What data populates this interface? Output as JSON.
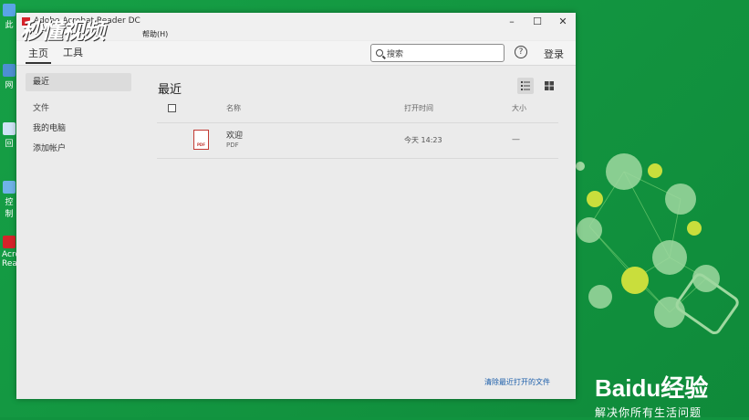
{
  "window": {
    "title": "Adobe Acrobat Reader DC",
    "menu_help": "帮助(H)",
    "controls": {
      "minimize": "–",
      "maximize": "☐",
      "close": "✕"
    }
  },
  "watermark": "秒懂视频",
  "toolbar": {
    "tabs": [
      {
        "label": "主页",
        "active": true
      },
      {
        "label": "工具",
        "active": false
      }
    ],
    "search_placeholder": "搜索",
    "help_icon": "?",
    "login_label": "登录"
  },
  "sidebar": {
    "recent": "最近",
    "files_header": "文件",
    "items": [
      "我的电脑",
      "添加帐户"
    ]
  },
  "main": {
    "title": "最近",
    "columns": {
      "name": "名称",
      "opened": "打开时间",
      "size": "大小"
    },
    "rows": [
      {
        "name": "欢迎",
        "type": "PDF",
        "opened": "今天 14:23",
        "size": "—"
      }
    ],
    "clear_link": "清除最近打开的文件"
  },
  "desktop_labels": {
    "this_pc": "此",
    "network": "网",
    "recycle": "回",
    "control": "控制",
    "acrobat": "Acro Read"
  },
  "branding": {
    "brand": "Baidu经验",
    "slogan": "解决你所有生活问题"
  },
  "colors": {
    "accent": "#d6232a",
    "desktop_green": "#11933f",
    "link_blue": "#1b5eaa"
  }
}
